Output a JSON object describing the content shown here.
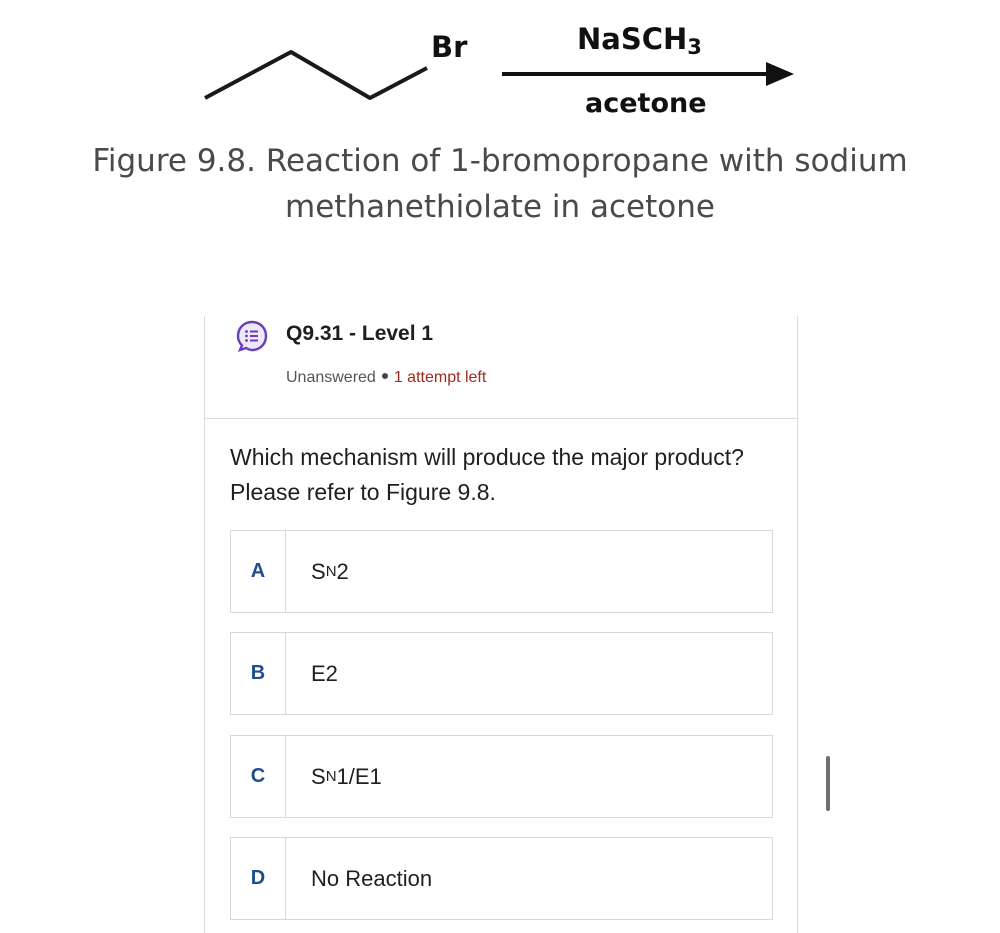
{
  "scheme": {
    "leaving_group": "Br",
    "reagent_main": "NaSCH",
    "reagent_sub": "3",
    "solvent": "acetone"
  },
  "figure_caption": "Figure 9.8. Reaction of 1-bromopropane with sodium methanethiolate in acetone",
  "question": {
    "title": "Q9.31 - Level 1",
    "status": "Unanswered",
    "attempts": "1 attempt left",
    "text": "Which mechanism will produce the major product? Please refer to Figure 9.8.",
    "options": [
      {
        "letter": "A",
        "text_main": "S",
        "text_sub": "N",
        "text_tail": "2"
      },
      {
        "letter": "B",
        "text": "E2"
      },
      {
        "letter": "C",
        "text_main": "S",
        "text_sub": "N",
        "text_tail": "1/E1"
      },
      {
        "letter": "D",
        "text": "No Reaction"
      }
    ]
  },
  "colors": {
    "letter": "#1e4f8c",
    "attempts": "#a12a1f",
    "icon": "#6a3fb5"
  }
}
